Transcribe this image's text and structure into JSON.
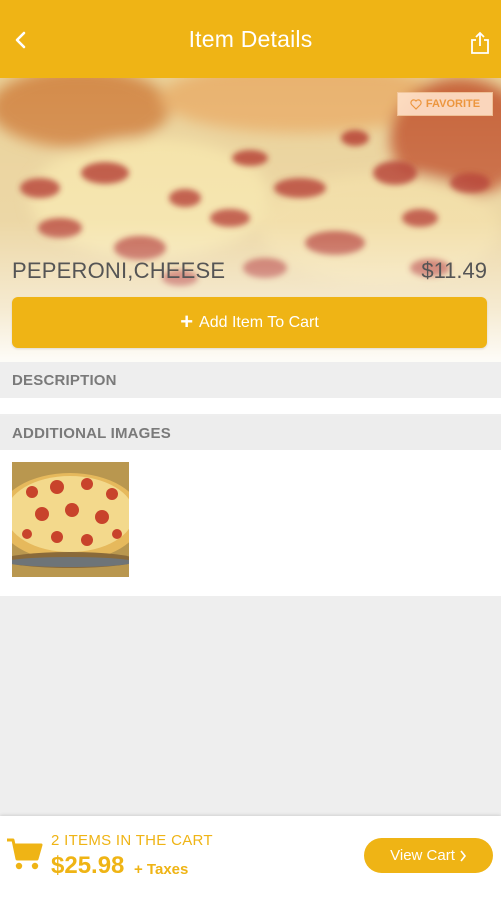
{
  "header": {
    "title": "Item Details",
    "back_icon": "chevron-left-icon",
    "share_icon": "share-icon"
  },
  "item": {
    "name": "PEPERONI,CHEESE",
    "price": "$11.49",
    "favorite_label": "FAVORITE",
    "add_to_cart_label": "Add Item To Cart"
  },
  "sections": {
    "description_label": "DESCRIPTION",
    "additional_images_label": "ADDITIONAL IMAGES"
  },
  "cart": {
    "count_text": "2 ITEMS IN THE CART",
    "total": "$25.98",
    "taxes_text": "+ Taxes",
    "view_cart_label": "View Cart"
  },
  "colors": {
    "accent": "#efb415",
    "favorite_text": "#f09a3e",
    "background": "#eeeeee"
  }
}
